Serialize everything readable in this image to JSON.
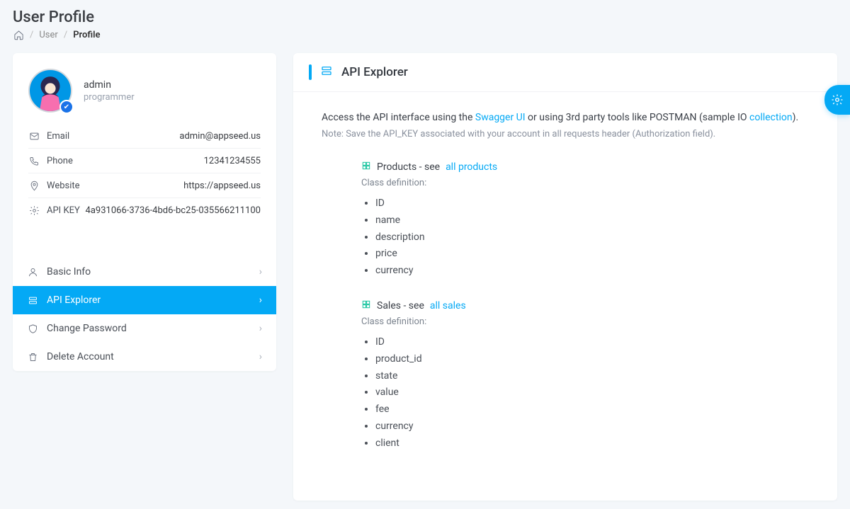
{
  "page": {
    "title": "User Profile"
  },
  "breadcrumb": {
    "user": "User",
    "profile": "Profile"
  },
  "profile": {
    "name": "admin",
    "role": "programmer"
  },
  "info": {
    "email_label": "Email",
    "email_value": "admin@appseed.us",
    "phone_label": "Phone",
    "phone_value": "12341234555",
    "website_label": "Website",
    "website_value": "https://appseed.us",
    "apikey_label": "API KEY",
    "apikey_value": "4a931066-3736-4bd6-bc25-035566211100"
  },
  "tabs": {
    "basic": "Basic Info",
    "api": "API Explorer",
    "pwd": "Change Password",
    "del": "Delete Account"
  },
  "panel": {
    "title": "API Explorer",
    "intro_pre": "Access the API interface using the ",
    "intro_link1": "Swagger UI",
    "intro_mid": " or using 3rd party tools like POSTMAN (sample IO ",
    "intro_link2": "collection",
    "intro_post": ").",
    "note": "Note: Save the API_KEY associated with your account in all requests header (Authorization field).",
    "classdef": "Class definition:",
    "products": {
      "label_pre": "Products - see ",
      "link": "all products",
      "fields": [
        "ID",
        "name",
        "description",
        "price",
        "currency"
      ]
    },
    "sales": {
      "label_pre": "Sales - see ",
      "link": "all sales",
      "fields": [
        "ID",
        "product_id",
        "state",
        "value",
        "fee",
        "currency",
        "client"
      ]
    }
  }
}
